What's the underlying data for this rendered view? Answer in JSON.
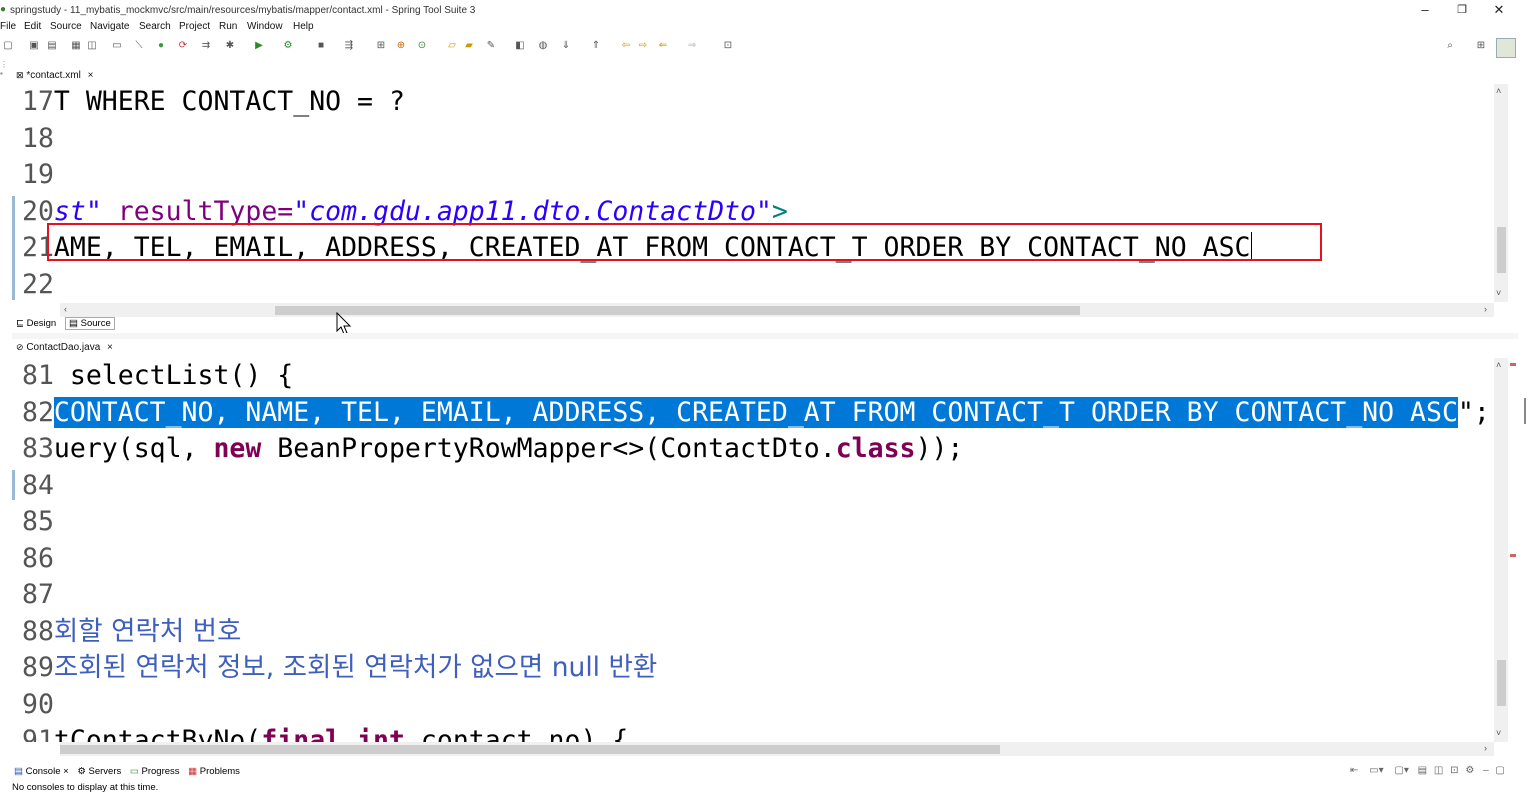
{
  "window": {
    "title": "springstudy - 11_mybatis_mockmvc/src/main/resources/mybatis/mapper/contact.xml - Spring Tool Suite 3",
    "min": "–",
    "max": "❐",
    "close": "✕"
  },
  "menu": [
    "File",
    "Edit",
    "Source",
    "Navigate",
    "Search",
    "Project",
    "Run",
    "Window",
    "Help"
  ],
  "editor1": {
    "tab_label": "*contact.xml",
    "lines": [
      {
        "no": "17",
        "text": "T WHERE CONTACT_NO = ?"
      },
      {
        "no": "18",
        "text": ""
      },
      {
        "no": "19",
        "text": ""
      },
      {
        "no": "20",
        "a": "st\"",
        "b": " resultType=",
        "c": "\"com.gdu.app11.dto.ContactDto\"",
        "d": ">"
      },
      {
        "no": "21",
        "text": "AME, TEL, EMAIL, ADDRESS, CREATED_AT FROM CONTACT_T ORDER BY CONTACT_NO ASC"
      },
      {
        "no": "22",
        "text": ""
      }
    ],
    "bottom_tabs": [
      "Design",
      "Source"
    ]
  },
  "editor2": {
    "tab_label": "ContactDao.java",
    "lines": [
      {
        "no": "81",
        "text": " selectList() {"
      },
      {
        "no": "82",
        "sel": "CONTACT_NO, NAME, TEL, EMAIL, ADDRESS, CREATED_AT FROM CONTACT_T ORDER BY CONTACT_NO ASC",
        "rest": "\";"
      },
      {
        "no": "83",
        "a": "uery(sql, ",
        "b": "new",
        "c": " BeanPropertyRowMapper<>(ContactDto.",
        "d": "class",
        "e": "));"
      },
      {
        "no": "84",
        "text": ""
      },
      {
        "no": "85",
        "text": ""
      },
      {
        "no": "86",
        "text": ""
      },
      {
        "no": "87",
        "text": ""
      },
      {
        "no": "88",
        "text": "회할 연락처 번호"
      },
      {
        "no": "89",
        "text": "조회된 연락처 정보, 조회된 연락처가 없으면 null 반환"
      },
      {
        "no": "90",
        "text": ""
      },
      {
        "no": "91",
        "a": "tContactByNo(",
        "b": "final",
        "c": " ",
        "d": "int",
        "e": " contact_no) {"
      }
    ]
  },
  "bottom_panel": {
    "tabs": [
      "Console",
      "Servers",
      "Progress",
      "Problems"
    ],
    "message": "No consoles to display at this time."
  },
  "colors": {
    "highlight_box": "#e8101b",
    "selection": "#0078d7"
  }
}
